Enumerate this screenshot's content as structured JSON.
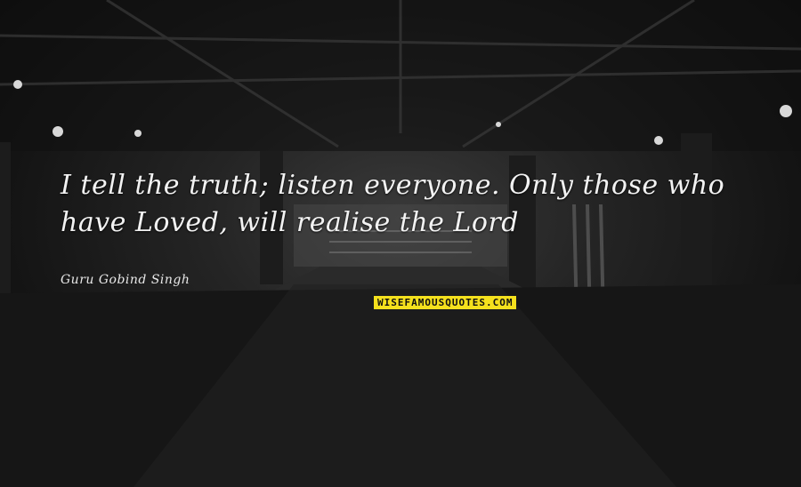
{
  "quote": {
    "text": "I tell the truth; listen everyone. Only those who have Loved, will realise the Lord",
    "author": "Guru Gobind Singh"
  },
  "watermark": {
    "text": "WISEFAMOUSQUOTES.COM"
  },
  "colors": {
    "quote_text": "#f2f2f2",
    "watermark_bg": "#f5e11d"
  },
  "background": {
    "icon": "gym-warehouse-photo"
  }
}
